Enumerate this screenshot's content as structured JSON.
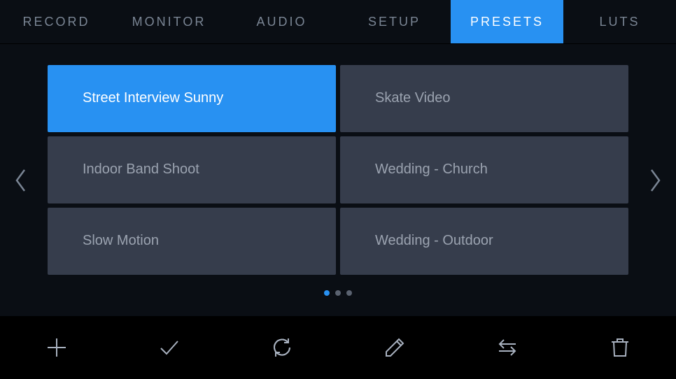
{
  "tabs": [
    {
      "label": "RECORD",
      "active": false
    },
    {
      "label": "MONITOR",
      "active": false
    },
    {
      "label": "AUDIO",
      "active": false
    },
    {
      "label": "SETUP",
      "active": false
    },
    {
      "label": "PRESETS",
      "active": true
    },
    {
      "label": "LUTS",
      "active": false
    }
  ],
  "presets": [
    {
      "label": "Street Interview Sunny",
      "selected": true
    },
    {
      "label": "Skate Video",
      "selected": false
    },
    {
      "label": "Indoor Band Shoot",
      "selected": false
    },
    {
      "label": "Wedding  - Church",
      "selected": false
    },
    {
      "label": "Slow Motion",
      "selected": false
    },
    {
      "label": "Wedding - Outdoor",
      "selected": false
    }
  ],
  "pagination": {
    "total": 3,
    "active": 0
  },
  "colors": {
    "accent": "#2891f2",
    "tile": "#363d4c",
    "bg": "#0a0e14",
    "textMuted": "#9ba3b0"
  }
}
